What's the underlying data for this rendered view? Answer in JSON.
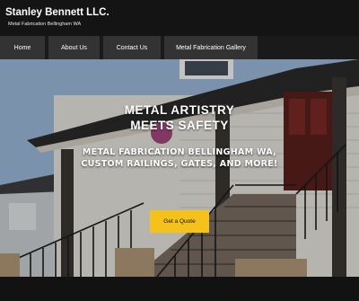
{
  "header": {
    "title": "Stanley Bennett LLC.",
    "tagline": "Metal Fabrication Bellingham WA"
  },
  "nav": {
    "items": [
      {
        "label": "Home"
      },
      {
        "label": "About Us"
      },
      {
        "label": "Contact Us"
      },
      {
        "label": "Metal Fabrication Gallery"
      }
    ]
  },
  "hero": {
    "heading_line1": "METAL ARTISTRY",
    "heading_line2": "MEETS SAFETY",
    "subheading": "METAL FABRICATION BELLINGHAM WA, CUSTOM RAILINGS, GATES, AND MORE!",
    "cta_label": "Get a Quote"
  },
  "colors": {
    "header_bg": "#141414",
    "nav_item_bg": "#333333",
    "cta_bg": "#f5c21b",
    "text": "#ffffff"
  }
}
